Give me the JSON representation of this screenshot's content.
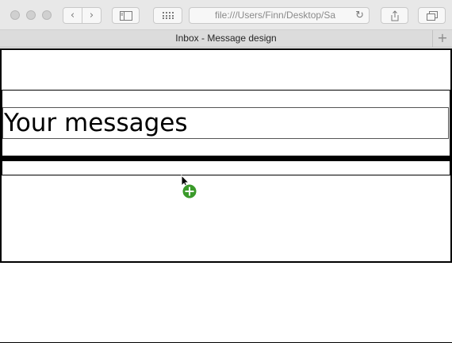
{
  "browser": {
    "url": "file:///Users/Finn/Desktop/Sa",
    "tab_title": "Inbox - Message design",
    "new_tab_symbol": "+"
  },
  "page": {
    "title": "Your messages"
  },
  "icons": {
    "back": "chevron-left-icon",
    "forward": "chevron-right-icon",
    "sidebar": "sidebar-icon",
    "grid": "grid-icon",
    "reload": "reload-icon",
    "share": "share-icon",
    "tabs": "tabs-overview-icon",
    "cursor": "copy-cursor-icon"
  },
  "colors": {
    "cursor_badge": "#3a9a2a"
  }
}
